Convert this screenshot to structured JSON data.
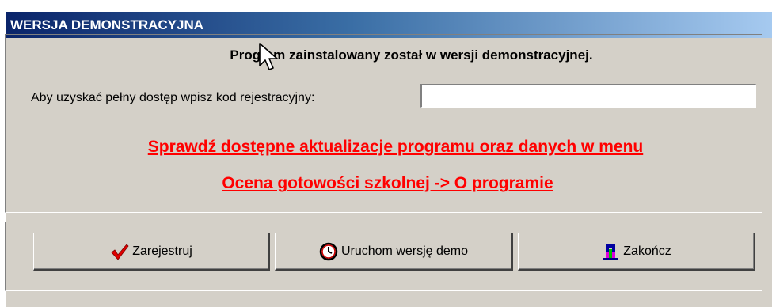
{
  "window": {
    "title": "WERSJA DEMONSTRACYJNA"
  },
  "main": {
    "heading": "Program zainstalowany został w wersji demonstracyjnej.",
    "registration_label": "Aby uzyskać pełny dostęp wpisz kod rejestracyjny:",
    "registration_value": "",
    "link_line1": "Sprawdź dostępne aktualizacje programu oraz danych w menu",
    "link_line2": "Ocena gotowości szkolnej -> O programie"
  },
  "buttons": {
    "register": {
      "label": "Zarejestruj",
      "icon": "checkmark-icon"
    },
    "demo": {
      "label": "Uruchom wersję demo",
      "icon": "clock-icon"
    },
    "exit": {
      "label": "Zakończ",
      "icon": "exit-door-icon"
    }
  },
  "colors": {
    "link": "#ff0000",
    "title_bar_start": "#0a246a",
    "title_bar_end": "#a6caf0",
    "dialog_bg": "#d4d0c8"
  }
}
